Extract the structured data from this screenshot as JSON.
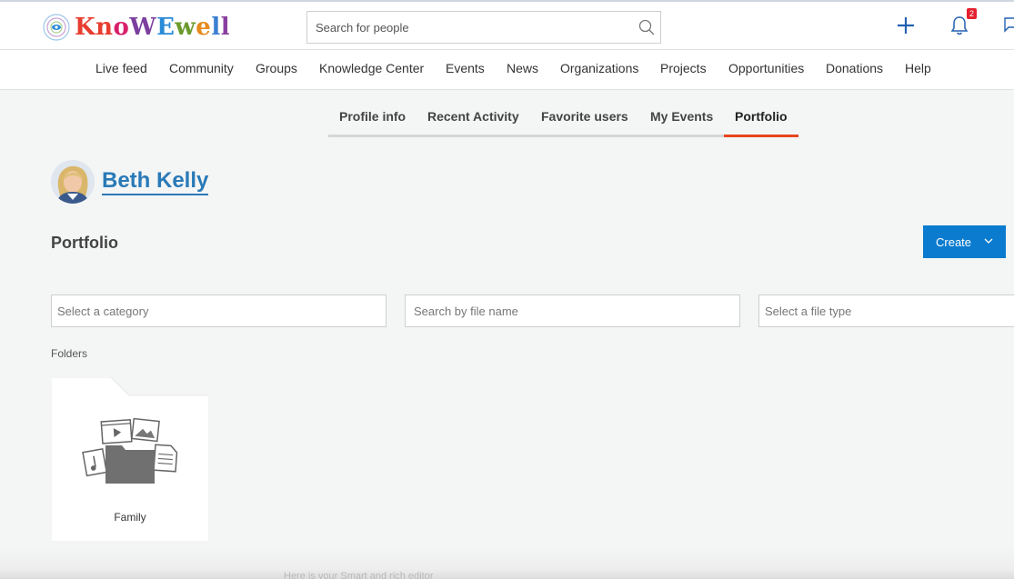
{
  "logo": {
    "letters": [
      "K",
      "n",
      "o",
      "W",
      "E",
      "w",
      "e",
      "l",
      "l"
    ],
    "letter_colors": [
      "#e73c2f",
      "#e73c2f",
      "#d81f6b",
      "#7b3f9e",
      "#2a8bd8",
      "#6a9a2c",
      "#e58a1d",
      "#3b7fd1",
      "#8b3fa0"
    ]
  },
  "search": {
    "placeholder": "Search for people"
  },
  "notifications": {
    "count": "2"
  },
  "nav": {
    "items": [
      "Live feed",
      "Community",
      "Groups",
      "Knowledge Center",
      "Events",
      "News",
      "Organizations",
      "Projects",
      "Opportunities",
      "Donations",
      "Help"
    ]
  },
  "profile_tabs": {
    "items": [
      "Profile info",
      "Recent Activity",
      "Favorite users",
      "My Events",
      "Portfolio"
    ],
    "active": "Portfolio"
  },
  "user": {
    "name": "Beth Kelly"
  },
  "portfolio": {
    "title": "Portfolio",
    "create_label": "Create",
    "filters": {
      "category_placeholder": "Select a category",
      "filename_placeholder": "Search by file name",
      "filetype_placeholder": "Select a file type"
    },
    "folders_label": "Folders",
    "folders": [
      {
        "name": "Family"
      }
    ]
  },
  "colors": {
    "accent": "#0a7bcf",
    "active_tab": "#e7461d",
    "link": "#2a7ab8",
    "badge": "#e5202e"
  },
  "footer_ghost_text": "Here is your Smart and rich editor"
}
